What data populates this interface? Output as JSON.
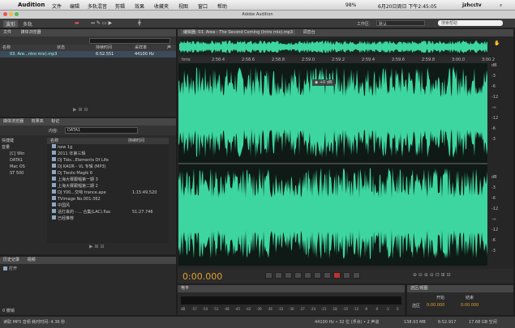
{
  "menubar": {
    "app": "Audition",
    "items": [
      "文件",
      "编辑",
      "多轨混音",
      "剪辑",
      "效果",
      "收藏夹",
      "视图",
      "窗口",
      "帮助"
    ],
    "status": {
      "battery": "98%",
      "datetime": "6月20日周日 下午2:45:05",
      "user": "jzhcctv"
    }
  },
  "window": {
    "title": "Adobe Audition"
  },
  "toolbar": {
    "waveform": "波形",
    "multitrack": "多轨",
    "workspace_label": "工作区:",
    "workspace_value": "默认",
    "search_placeholder": "搜索帮助"
  },
  "files_panel": {
    "title": "文件",
    "tab2": "媒体浏览器",
    "cols": [
      "名称",
      "状态",
      "持续时间",
      "采样率",
      "声"
    ],
    "files": [
      {
        "name": "03. Are...ntro mix).mp3",
        "duration": "6:52.551",
        "rate": "44100 Hz"
      }
    ]
  },
  "media_browser": {
    "tabs": [
      "媒体浏览器",
      "效果夹",
      "标记"
    ],
    "content_label": "内容:",
    "content_value": "DATA1",
    "tree": [
      "快捷键",
      "音量",
      "[C] Win",
      "DATA1",
      "Mac OS",
      "ST 500"
    ],
    "cols": [
      "名称",
      "持续时间"
    ],
    "files": [
      {
        "name": "new 1g",
        "dur": ""
      },
      {
        "name": "2011 年第三辑",
        "dur": ""
      },
      {
        "name": "DJ Tiës...Elements Of Life",
        "dur": ""
      },
      {
        "name": "DJ KAOR - VL 专辑 (MP3)",
        "dur": ""
      },
      {
        "name": "Dj Tiesto Magik 6",
        "dur": ""
      },
      {
        "name": "上海大赛跟唱第一期 3",
        "dur": ""
      },
      {
        "name": "上海大赛跟唱第二期 2",
        "dur": ""
      },
      {
        "name": "DJ Y00...交响 trance.ape",
        "dur": "1:15:49.520"
      },
      {
        "name": "TVimage No.001-362",
        "dur": ""
      },
      {
        "name": "中国风",
        "dur": ""
      },
      {
        "name": "话打来的 - ... 合集(LAC).flac",
        "dur": "51:27.746"
      },
      {
        "name": "已经推荐",
        "dur": ""
      }
    ]
  },
  "history_panel": {
    "tabs": [
      "历史记录",
      "视频"
    ],
    "item": "打开",
    "count": "0 撤销"
  },
  "editor": {
    "tab": "编辑器: 03. Area - The Second Coming (Intro mix).mp3",
    "tab2": "调音台",
    "time_ticks": [
      "hms",
      "2:58.4",
      "2:58.6",
      "2:58.8",
      "2:59.0",
      "2:59.2",
      "2:59.4",
      "2:59.6",
      "2:59.8",
      "3:00.0",
      "3:00.2"
    ],
    "hud_db": "+0 dB",
    "db_scale_top": [
      "dB",
      "-3",
      "-6",
      "-12",
      "-∞",
      "-12",
      "-6",
      "-3"
    ],
    "db_scale_bottom": [
      "dB",
      "-3",
      "-6",
      "-12",
      "-∞",
      "-12",
      "-6",
      "-3"
    ],
    "current_time": "0:00.000"
  },
  "levels": {
    "title": "电平",
    "ticks": [
      "dB",
      "-57",
      "-54",
      "-51",
      "-48",
      "-45",
      "-42",
      "-39",
      "-36",
      "-33",
      "-30",
      "-27",
      "-24",
      "-21",
      "-18",
      "-15",
      "-12",
      "-9",
      "-6",
      "-3",
      "0"
    ]
  },
  "selection": {
    "title": "选区/视图",
    "headers": [
      "开始",
      "结束"
    ],
    "label": "选区",
    "start": "0:00.000",
    "end": "0:00.000"
  },
  "statusbar": {
    "left": "读取 MP3 音频 耗时时间: 4.36 秒",
    "right": [
      "44100 Hz • 32 位 (浮点) • 2 声道",
      "138.93 MB",
      "6:52.917",
      "17.68 GB 空闲"
    ]
  },
  "colors": {
    "waveform": "#3dd6a0",
    "bg": "#1e1e1e",
    "timecode": "#e0a030"
  }
}
